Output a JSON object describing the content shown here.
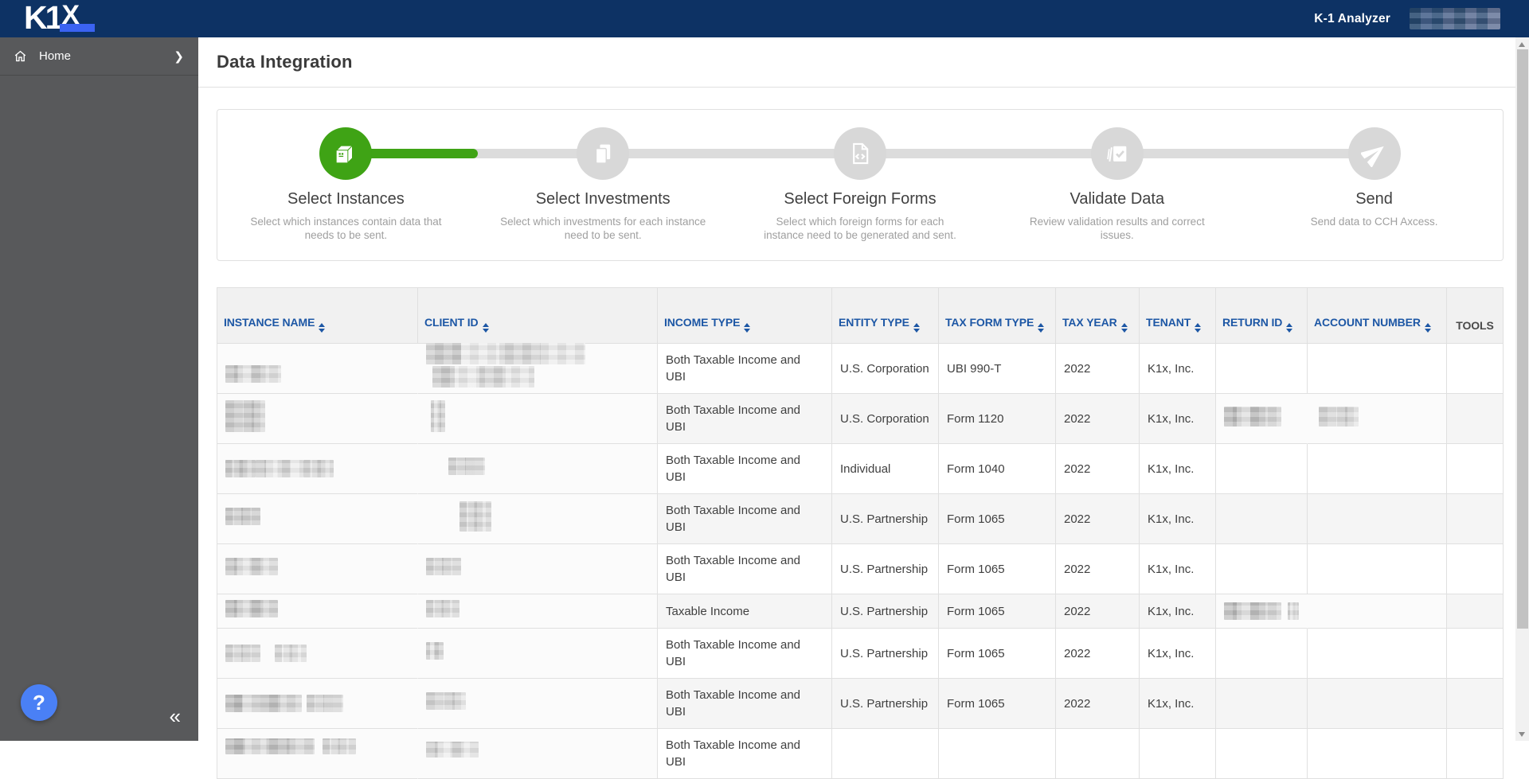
{
  "navbar": {
    "logo_k1": "K1",
    "logo_x": "X",
    "product": "K-1 Analyzer",
    "user_name_redacted": true
  },
  "sidebar": {
    "items": [
      {
        "label": "Home"
      }
    ],
    "help_label": "?",
    "collapse_glyph": "«"
  },
  "page": {
    "title": "Data Integration"
  },
  "stepper": {
    "steps": [
      {
        "title": "Select Instances",
        "description": "Select which instances contain data that needs to be sent.",
        "state": "active",
        "icon": "package-icon"
      },
      {
        "title": "Select Investments",
        "description": "Select which investments for each instance need to be sent.",
        "state": "upcoming",
        "icon": "documents-icon"
      },
      {
        "title": "Select Foreign Forms",
        "description": "Select which foreign forms for each instance need to be generated and sent.",
        "state": "upcoming",
        "icon": "code-file-icon"
      },
      {
        "title": "Validate Data",
        "description": "Review validation results and correct issues.",
        "state": "upcoming",
        "icon": "validate-icon"
      },
      {
        "title": "Send",
        "description": "Send data to CCH Axcess.",
        "state": "upcoming",
        "icon": "send-icon"
      }
    ]
  },
  "table": {
    "columns": [
      {
        "key": "instance_name",
        "label": "INSTANCE NAME",
        "sortable": true
      },
      {
        "key": "client_id",
        "label": "CLIENT ID",
        "sortable": true
      },
      {
        "key": "income_type",
        "label": "INCOME TYPE",
        "sortable": true
      },
      {
        "key": "entity_type",
        "label": "ENTITY TYPE",
        "sortable": true
      },
      {
        "key": "tax_form_type",
        "label": "TAX FORM TYPE",
        "sortable": true
      },
      {
        "key": "tax_year",
        "label": "TAX YEAR",
        "sortable": true
      },
      {
        "key": "tenant",
        "label": "TENANT",
        "sortable": true
      },
      {
        "key": "return_id",
        "label": "RETURN ID",
        "sortable": true
      },
      {
        "key": "account_number",
        "label": "ACCOUNT NUMBER",
        "sortable": true
      },
      {
        "key": "tools",
        "label": "TOOLS",
        "sortable": false
      }
    ],
    "rows": [
      {
        "income_type": "Both Taxable Income and UBI",
        "entity_type": "U.S. Corporation",
        "tax_form_type": "UBI 990-T",
        "tax_year": "2022",
        "tenant": "K1x, Inc.",
        "redacted_fields": [
          "instance_name",
          "client_id"
        ]
      },
      {
        "income_type": "Both Taxable Income and UBI",
        "entity_type": "U.S. Corporation",
        "tax_form_type": "Form 1120",
        "tax_year": "2022",
        "tenant": "K1x, Inc.",
        "redacted_fields": [
          "instance_name",
          "client_id",
          "return_id",
          "account_number"
        ]
      },
      {
        "income_type": "Both Taxable Income and UBI",
        "entity_type": "Individual",
        "tax_form_type": "Form 1040",
        "tax_year": "2022",
        "tenant": "K1x, Inc.",
        "redacted_fields": [
          "instance_name",
          "client_id"
        ]
      },
      {
        "income_type": "Both Taxable Income and UBI",
        "entity_type": "U.S. Partnership",
        "tax_form_type": "Form 1065",
        "tax_year": "2022",
        "tenant": "K1x, Inc.",
        "redacted_fields": [
          "instance_name",
          "client_id"
        ]
      },
      {
        "income_type": "Both Taxable Income and UBI",
        "entity_type": "U.S. Partnership",
        "tax_form_type": "Form 1065",
        "tax_year": "2022",
        "tenant": "K1x, Inc.",
        "redacted_fields": [
          "instance_name",
          "client_id"
        ]
      },
      {
        "income_type": "Taxable Income",
        "entity_type": "U.S. Partnership",
        "tax_form_type": "Form 1065",
        "tax_year": "2022",
        "tenant": "K1x, Inc.",
        "redacted_fields": [
          "instance_name",
          "client_id",
          "return_id"
        ]
      },
      {
        "income_type": "Both Taxable Income and UBI",
        "entity_type": "U.S. Partnership",
        "tax_form_type": "Form 1065",
        "tax_year": "2022",
        "tenant": "K1x, Inc.",
        "redacted_fields": [
          "instance_name",
          "client_id"
        ]
      },
      {
        "income_type": "Both Taxable Income and UBI",
        "entity_type": "U.S. Partnership",
        "tax_form_type": "Form 1065",
        "tax_year": "2022",
        "tenant": "K1x, Inc.",
        "redacted_fields": [
          "instance_name",
          "client_id"
        ]
      },
      {
        "income_type": "Both Taxable Income and UBI",
        "entity_type": "",
        "tax_form_type": "",
        "tax_year": "",
        "tenant": "",
        "redacted_fields": [
          "instance_name",
          "client_id"
        ]
      }
    ]
  },
  "colors": {
    "navbar_navy": "#0d3264",
    "logo_underline_blue": "#3b63f2",
    "sidebar_gray": "#58595b",
    "help_button_blue": "#4a80f5",
    "step_active_green": "#3fa315",
    "step_inactive_gray": "#d8d8d8",
    "header_text_blue": "#1d57a5",
    "table_border": "#e0e0e0",
    "row_shade": "#f5f5f5"
  }
}
